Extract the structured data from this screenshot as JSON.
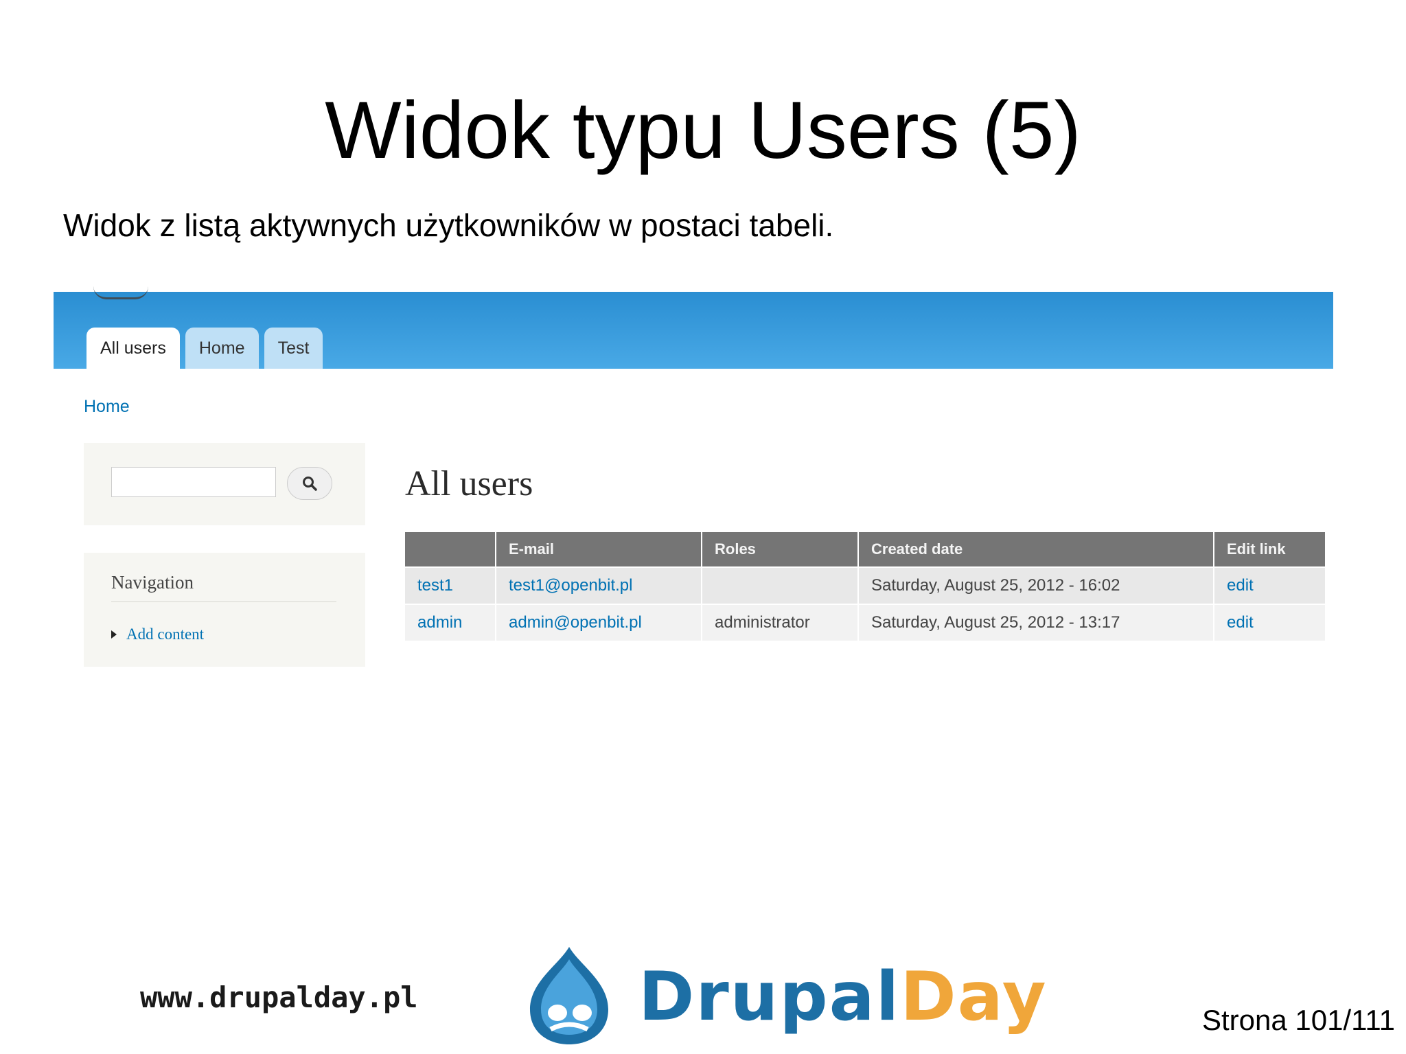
{
  "slide": {
    "title": "Widok typu Users (5)",
    "subtitle": "Widok z listą aktywnych użytkowników w postaci tabeli."
  },
  "site": {
    "tabs": [
      {
        "label": "All users",
        "active": true
      },
      {
        "label": "Home",
        "active": false
      },
      {
        "label": "Test",
        "active": false
      }
    ],
    "breadcrumb": "Home",
    "search": {
      "value": "",
      "icon": "search-icon"
    },
    "navigation": {
      "title": "Navigation",
      "items": [
        "Add content"
      ]
    },
    "page_title": "All users",
    "table": {
      "headers": [
        "",
        "E-mail",
        "Roles",
        "Created date",
        "Edit link"
      ],
      "rows": [
        {
          "name": "test1",
          "email": "test1@openbit.pl",
          "roles": "",
          "created": "Saturday, August 25, 2012 - 16:02",
          "edit": "edit"
        },
        {
          "name": "admin",
          "email": "admin@openbit.pl",
          "roles": "administrator",
          "created": "Saturday, August 25, 2012 - 13:17",
          "edit": "edit"
        }
      ]
    },
    "colors": {
      "header_blue": "#2a8ed2",
      "link": "#0071b3",
      "table_header": "#757575"
    }
  },
  "footer": {
    "url": "www.drupalday.pl",
    "brand_part1": "Drupal",
    "brand_part2": "Day",
    "page": "Strona 101/111"
  }
}
